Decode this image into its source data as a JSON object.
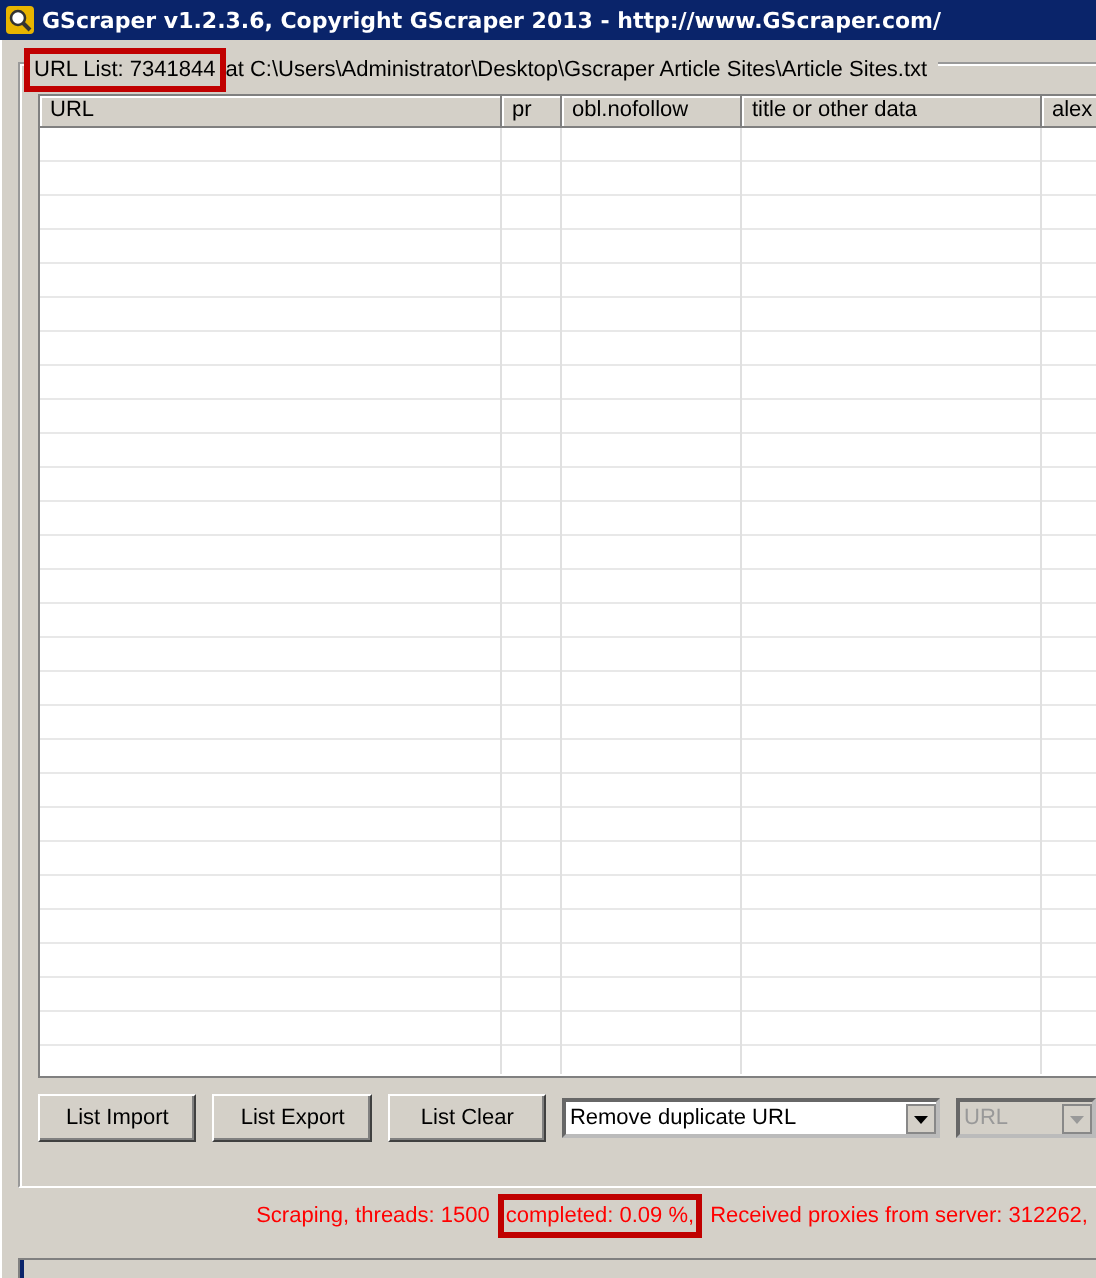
{
  "window": {
    "title": "GScraper v1.2.3.6, Copyright GScraper 2013 - http://www.GScraper.com/"
  },
  "group": {
    "count_label": "URL List: 7341844",
    "path_label": "at C:\\Users\\Administrator\\Desktop\\Gscraper Article Sites\\Article Sites.txt",
    "highlighted": true
  },
  "table": {
    "columns": [
      "URL",
      "pr",
      "obl.nofollow",
      "title or other data",
      "alex"
    ]
  },
  "buttons": [
    "List Import",
    "List Export",
    "List Clear"
  ],
  "dropdowns": [
    {
      "value": "Remove duplicate URL",
      "disabled": false
    },
    {
      "value": "URL",
      "disabled": true
    }
  ],
  "status": [
    {
      "text": "Scraping, threads: 1500",
      "highlighted": false
    },
    {
      "text": "completed: 0.09 %,",
      "highlighted": true
    },
    {
      "text": "Received proxies from server: 312262,",
      "highlighted": false
    }
  ],
  "progress": {
    "level": 0.001
  }
}
